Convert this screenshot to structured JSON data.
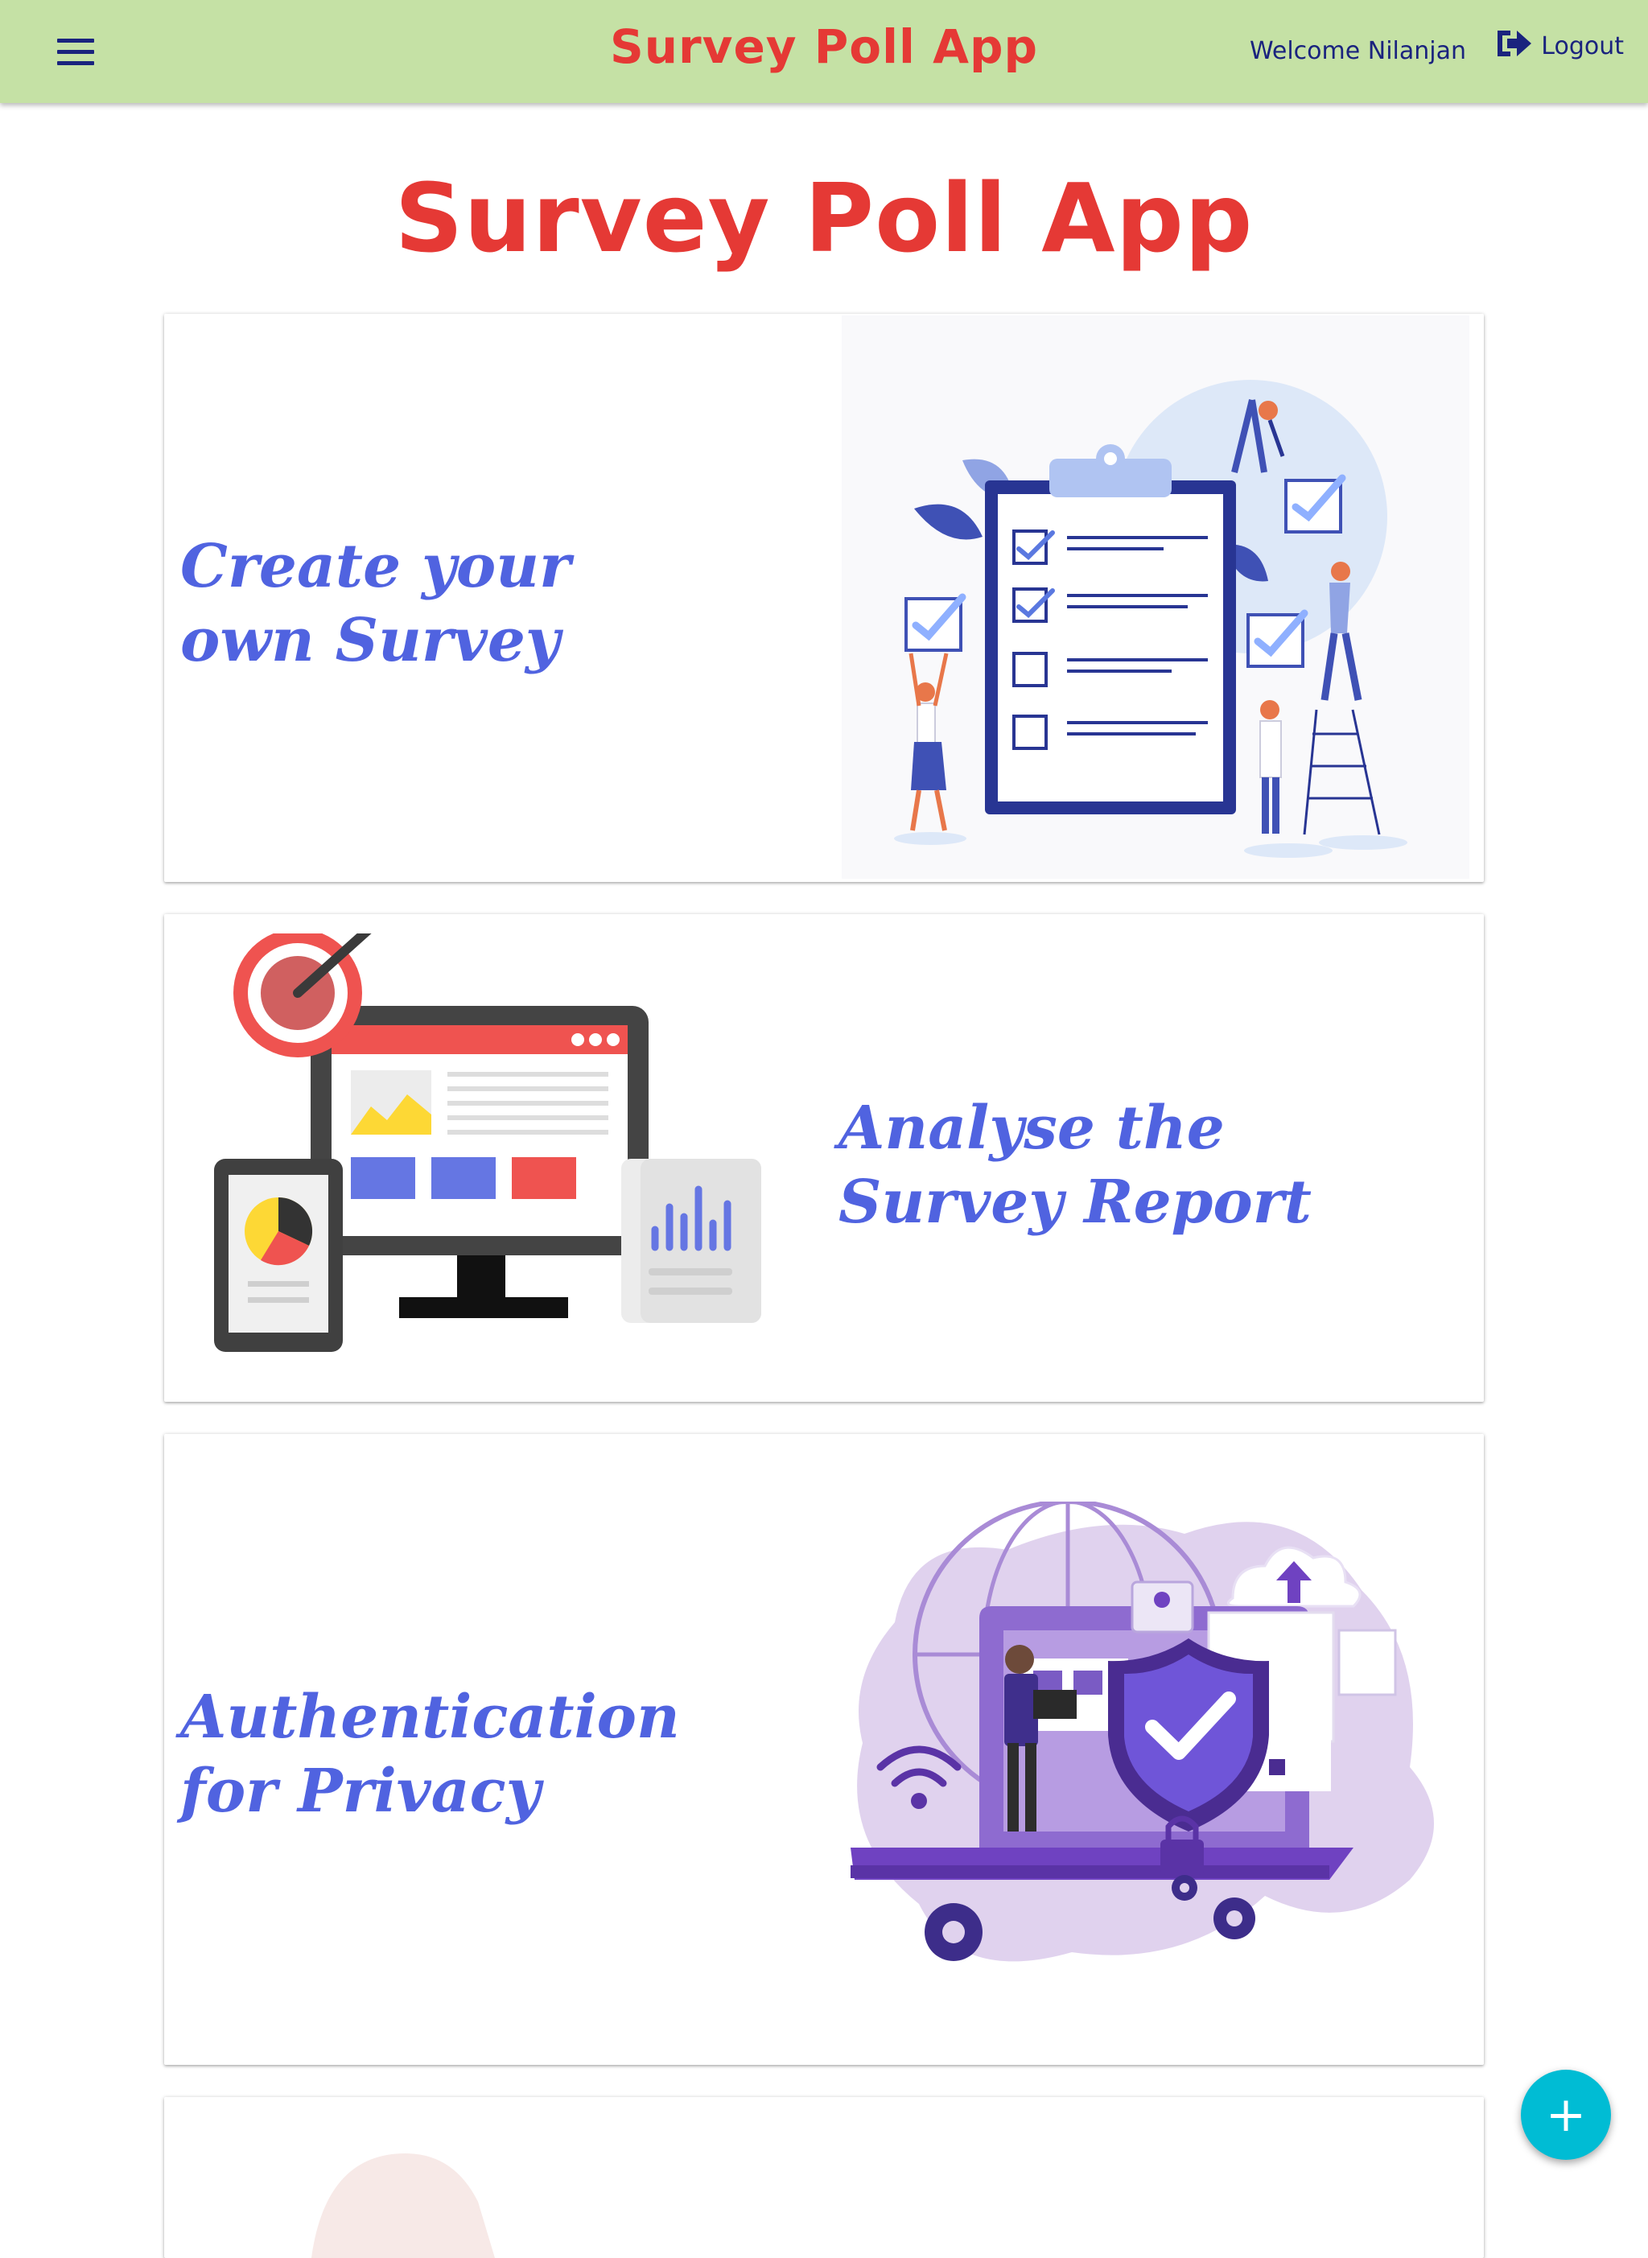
{
  "appbar": {
    "title": "Survey Poll App",
    "welcome": "Welcome Nilanjan",
    "logout_label": "Logout",
    "menu_icon": "hamburger-menu-icon",
    "logout_icon": "sign-out-icon"
  },
  "hero": {
    "title": "Survey Poll App"
  },
  "features": [
    {
      "title": "Create your own Survey",
      "illustration": "clipboard-checklist-illustration"
    },
    {
      "title": "Analyse the Survey Report",
      "illustration": "dashboard-analytics-illustration"
    },
    {
      "title": "Authentication for Privacy",
      "illustration": "security-shield-illustration"
    }
  ],
  "fab": {
    "label": "+",
    "icon": "add-icon"
  },
  "colors": {
    "appbar_bg": "#c5e1a5",
    "title_red": "#e53935",
    "feature_text": "#5063e0",
    "fab": "#00bcd4",
    "nav_text": "#1a237e"
  }
}
